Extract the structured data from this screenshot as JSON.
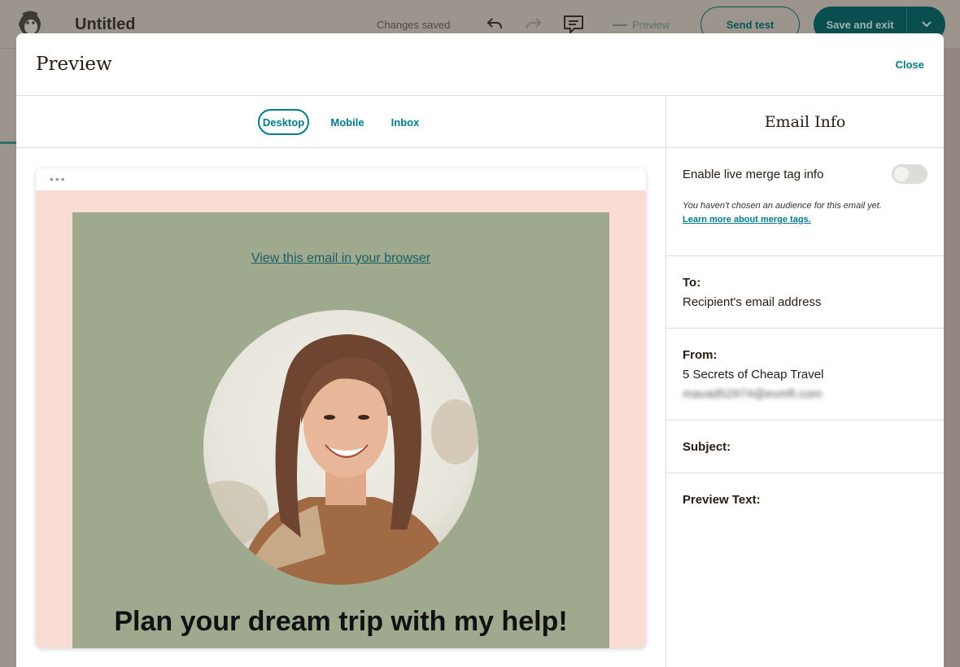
{
  "editor": {
    "doc_title": "Untitled",
    "status": "Changes saved",
    "preview_label": "Preview",
    "send_test_label": "Send test",
    "save_exit_label": "Save and exit"
  },
  "modal": {
    "title": "Preview",
    "close_label": "Close",
    "tabs": [
      {
        "label": "Desktop",
        "active": true
      },
      {
        "label": "Mobile",
        "active": false
      },
      {
        "label": "Inbox",
        "active": false
      }
    ],
    "email": {
      "view_in_browser": "View this email in your browser",
      "headline": "Plan your dream trip with my help!"
    },
    "info": {
      "title": "Email Info",
      "merge_toggle_label": "Enable live merge tag info",
      "merge_toggle_on": false,
      "merge_note": "You haven't chosen an audience for this email yet.",
      "merge_learn_link": "Learn more about merge tags.",
      "to_label": "To:",
      "to_value": "Recipient's email address",
      "from_label": "From:",
      "from_name": "5 Secrets of Cheap Travel",
      "from_email": "mavad52974@evmft.com",
      "subject_label": "Subject:",
      "preview_text_label": "Preview Text:"
    }
  },
  "colors": {
    "accent": "#007c89",
    "email_bg": "#f9ddd4",
    "email_body": "#9ea98e",
    "primary_button": "#0a4e50"
  }
}
